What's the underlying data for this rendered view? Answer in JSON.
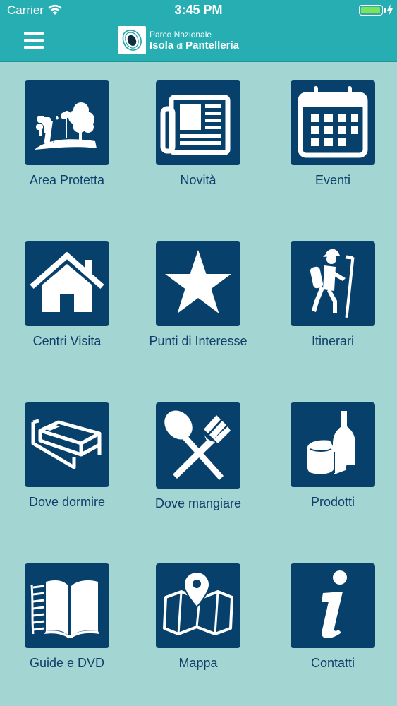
{
  "status_bar": {
    "carrier": "Carrier",
    "time": "3:45 PM",
    "battery_fraction": 1.0,
    "battery_color": "#7ee35a"
  },
  "header": {
    "menu_icon": "hamburger-menu-icon",
    "logo_icon": "park-logo-icon",
    "logo_subtitle": "Parco Nazionale",
    "logo_title_a": "Isola",
    "logo_title_di": "di",
    "logo_title_b": "Pantelleria",
    "bar_color": "#27aeb3"
  },
  "colors": {
    "background": "#a3d6d3",
    "tile": "#08406c",
    "label": "#0d3f6a"
  },
  "menu": [
    {
      "label": "Area Protetta",
      "icon": "protected-area-icon"
    },
    {
      "label": "Novità",
      "icon": "newspaper-icon"
    },
    {
      "label": "Eventi",
      "icon": "calendar-icon"
    },
    {
      "label": "Centri Visita",
      "icon": "house-icon"
    },
    {
      "label": "Punti di Interesse",
      "icon": "star-icon"
    },
    {
      "label": "Itinerari",
      "icon": "hiker-icon"
    },
    {
      "label": "Dove dormire",
      "icon": "bed-icon"
    },
    {
      "label": "Dove mangiare",
      "icon": "fork-spoon-icon"
    },
    {
      "label": "Prodotti",
      "icon": "cheese-bottle-icon"
    },
    {
      "label": "Guide e DVD",
      "icon": "book-icon"
    },
    {
      "label": "Mappa",
      "icon": "map-pin-icon"
    },
    {
      "label": "Contatti",
      "icon": "info-icon"
    }
  ]
}
